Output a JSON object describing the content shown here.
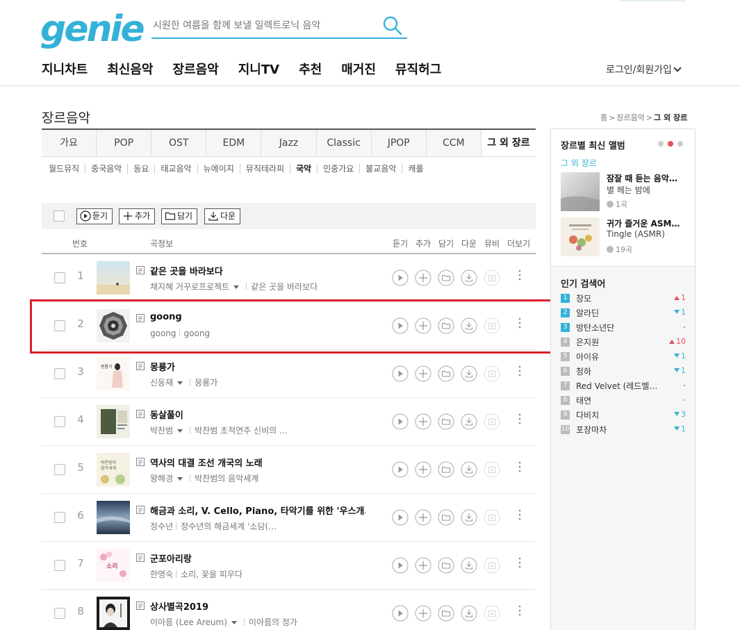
{
  "header": {
    "logo": "genie",
    "search_placeholder": "시원한 여름을 함께 보낼 일렉트로닉 음악",
    "nav": [
      "지니차트",
      "최신음악",
      "장르음악",
      "지니TV",
      "추천",
      "매거진",
      "뮤직허그"
    ],
    "login": "로그인/회원가입"
  },
  "page": {
    "title": "장르음악",
    "breadcrumb": [
      "홈",
      "장르음악",
      "그 외 장르"
    ]
  },
  "genre_tabs": [
    "가요",
    "POP",
    "OST",
    "EDM",
    "Jazz",
    "Classic",
    "JPOP",
    "CCM",
    "그 외 장르"
  ],
  "active_tab": 8,
  "subgenres": [
    "월드뮤직",
    "중국음악",
    "동요",
    "태교음악",
    "뉴에이지",
    "뮤직테라피",
    "국악",
    "민중가요",
    "불교음악",
    "캐롤"
  ],
  "active_subgenre": 6,
  "toolbar": {
    "play": "듣기",
    "add": "추가",
    "save": "담기",
    "download": "다운"
  },
  "columns": {
    "num": "번호",
    "info": "곡정보",
    "listen": "듣기",
    "add": "추가",
    "save": "담기",
    "down": "다운",
    "mv": "뮤비",
    "more": "더보기"
  },
  "songs": [
    {
      "rank": "1",
      "title": "같은 곳을 바라보다",
      "artist": "채지혜 거꾸로프로젝트",
      "album": "같은 곳을 바라보다",
      "has_artist_menu": true
    },
    {
      "rank": "2",
      "title": "goong",
      "artist": "goong",
      "album": "goong",
      "has_artist_menu": false
    },
    {
      "rank": "3",
      "title": "몽룡가",
      "artist": "신동재",
      "album": "몽룡가",
      "has_artist_menu": true
    },
    {
      "rank": "4",
      "title": "동살풀이",
      "artist": "박찬범",
      "album": "박찬범 초적연주 신비의 …",
      "has_artist_menu": true
    },
    {
      "rank": "5",
      "title": "역사의 대결 조선 개국의 노래",
      "artist": "왕해경",
      "album": "박찬범의 음악세계",
      "has_artist_menu": true
    },
    {
      "rank": "6",
      "title": "해금과 소리, V. Cello, Piano, 타악기를 위한 '우스개…",
      "artist": "정수년",
      "album": "정수년의 해금세계 '소담(…",
      "has_artist_menu": false
    },
    {
      "rank": "7",
      "title": "군포아리랑",
      "artist": "한영숙",
      "album": "소리, 꽃을 피우다",
      "has_artist_menu": false
    },
    {
      "rank": "8",
      "title": "상사별곡2019",
      "artist": "이아름 (Lee Areum)",
      "album": "이아름의 정가",
      "has_artist_menu": true
    }
  ],
  "panel": {
    "title": "장르별 최신 앨범",
    "genre": "그 외 장르",
    "albums": [
      {
        "title": "잠잘 때 듣는 음악…",
        "artist": "별 헤는 밤에",
        "count": "1곡"
      },
      {
        "title": "귀가 즐거운 ASM…",
        "artist": "Tingle (ASMR)",
        "count": "19곡"
      }
    ],
    "popular_title": "인기 검색어",
    "popular": [
      {
        "num": "1",
        "word": "창모",
        "dir": "up",
        "chg": "1"
      },
      {
        "num": "2",
        "word": "알라딘",
        "dir": "down",
        "chg": "1"
      },
      {
        "num": "3",
        "word": "방탄소년단",
        "dir": "same",
        "chg": "-"
      },
      {
        "num": "4",
        "word": "은지원",
        "dir": "up",
        "chg": "10"
      },
      {
        "num": "5",
        "word": "아이유",
        "dir": "down",
        "chg": "1"
      },
      {
        "num": "6",
        "word": "청하",
        "dir": "down",
        "chg": "1"
      },
      {
        "num": "7",
        "word": "Red Velvet (레드벨…",
        "dir": "same",
        "chg": "-"
      },
      {
        "num": "8",
        "word": "태연",
        "dir": "same",
        "chg": "-"
      },
      {
        "num": "9",
        "word": "다비치",
        "dir": "down",
        "chg": "3"
      },
      {
        "num": "10",
        "word": "포장마차",
        "dir": "down",
        "chg": "1"
      }
    ]
  },
  "colors": {
    "brand": "#35b1d8",
    "highlight": "#d9212a",
    "up": "#e2505b"
  }
}
